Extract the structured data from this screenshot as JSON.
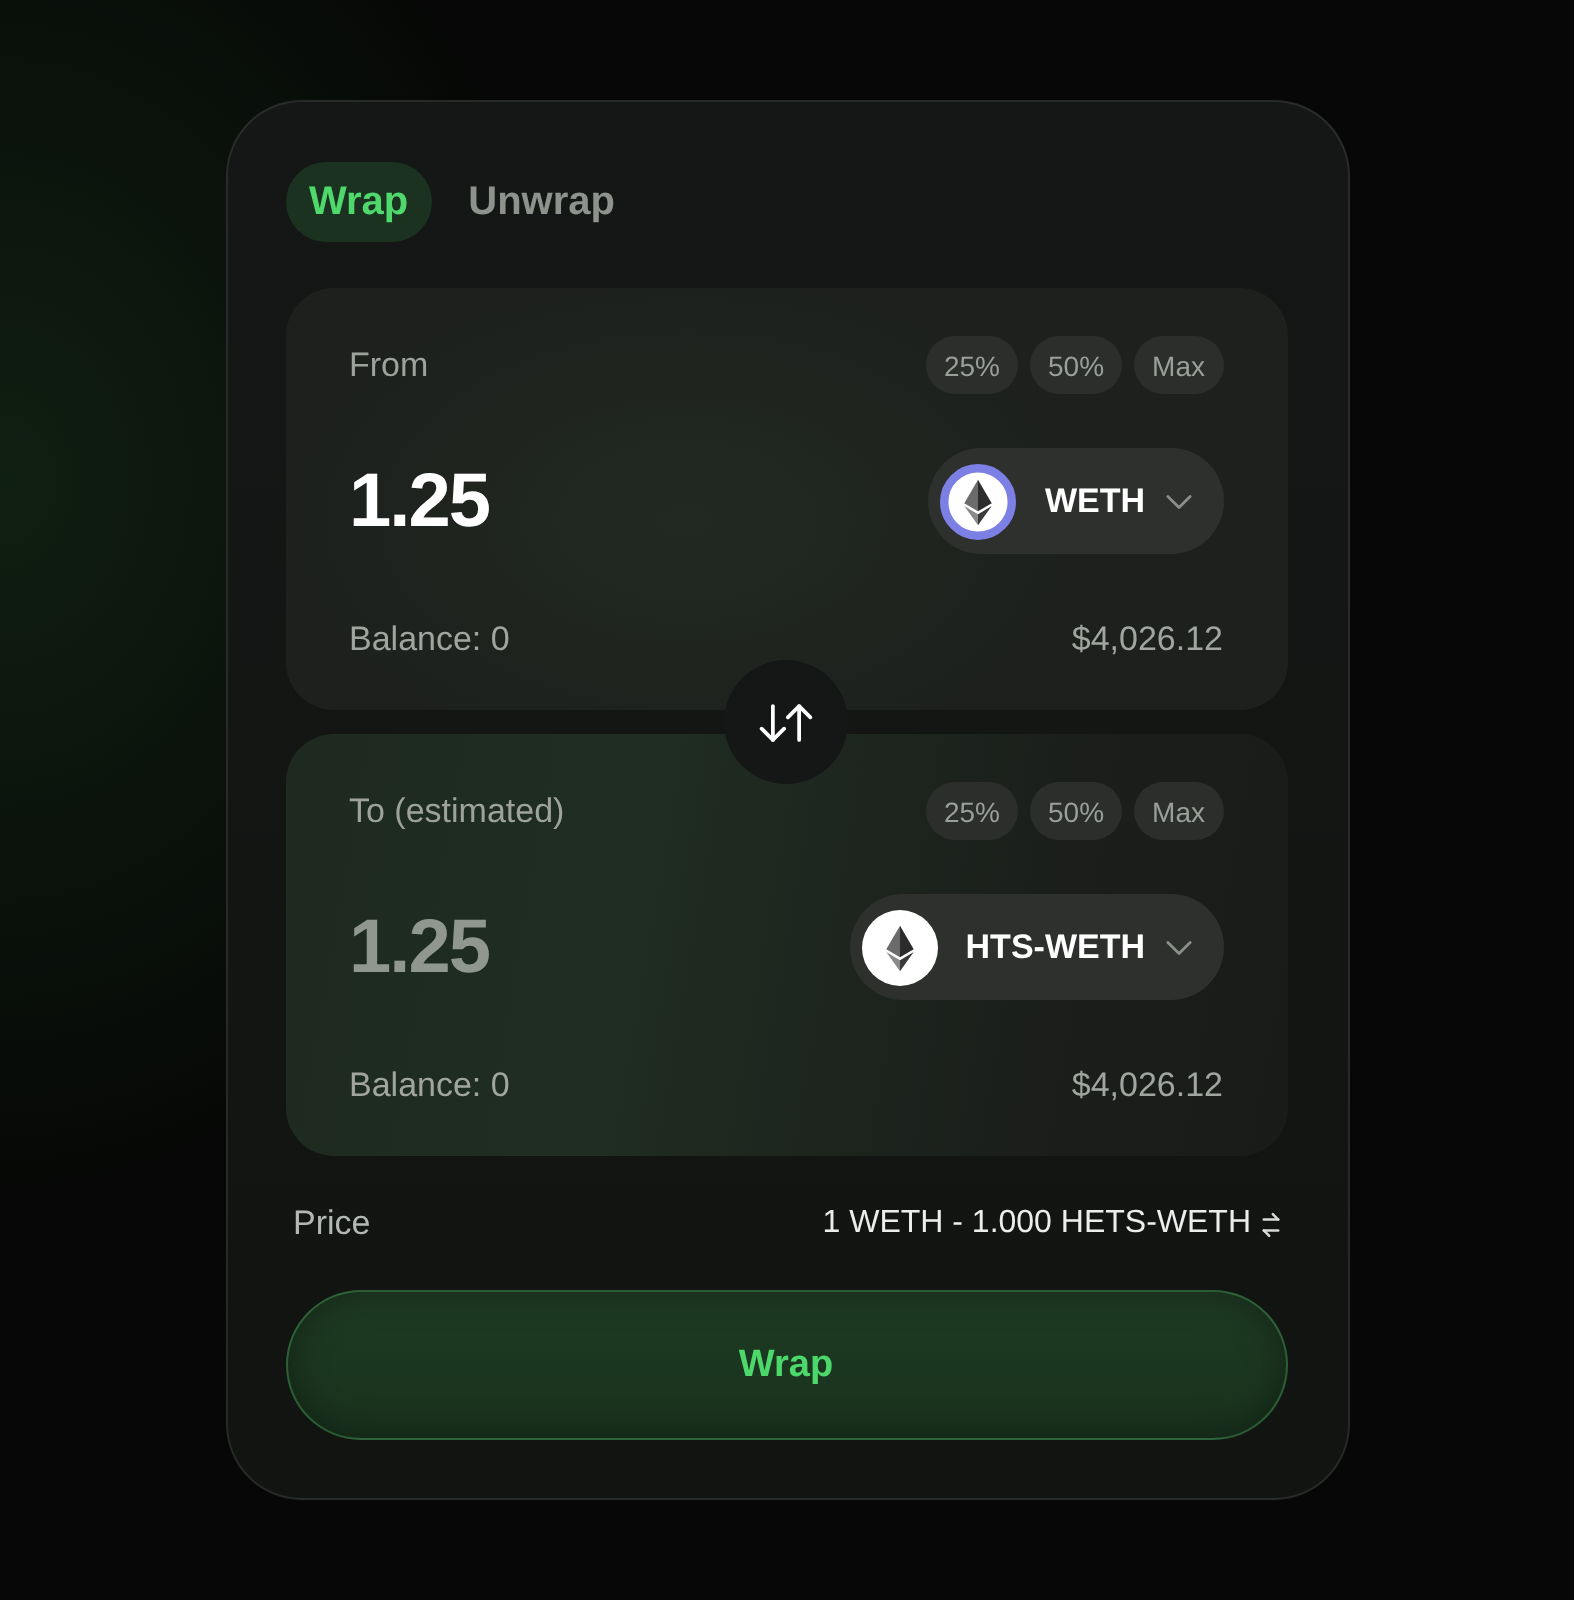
{
  "tabs": [
    {
      "label": "Wrap",
      "selected": true
    },
    {
      "label": "Unwrap",
      "selected": false
    }
  ],
  "panels": [
    {
      "label": "From",
      "chips": [
        "25%",
        "50%",
        "Max"
      ],
      "amount": "1.25",
      "dimmed": false,
      "token": {
        "symbol": "WETH",
        "outlined": true
      },
      "balance": "Balance: 0",
      "value": "$4,026.12"
    },
    {
      "label": "To (estimated)",
      "chips": [
        "25%",
        "50%",
        "Max"
      ],
      "amount": "1.25",
      "dimmed": true,
      "token": {
        "symbol": "HTS-WETH",
        "outlined": false
      },
      "balance": "Balance: 0",
      "value": "$4,026.12"
    }
  ],
  "price": {
    "label": "Price",
    "value": "1 WETH - 1.000 HETS-WETH"
  },
  "submit": {
    "label": "Wrap"
  }
}
